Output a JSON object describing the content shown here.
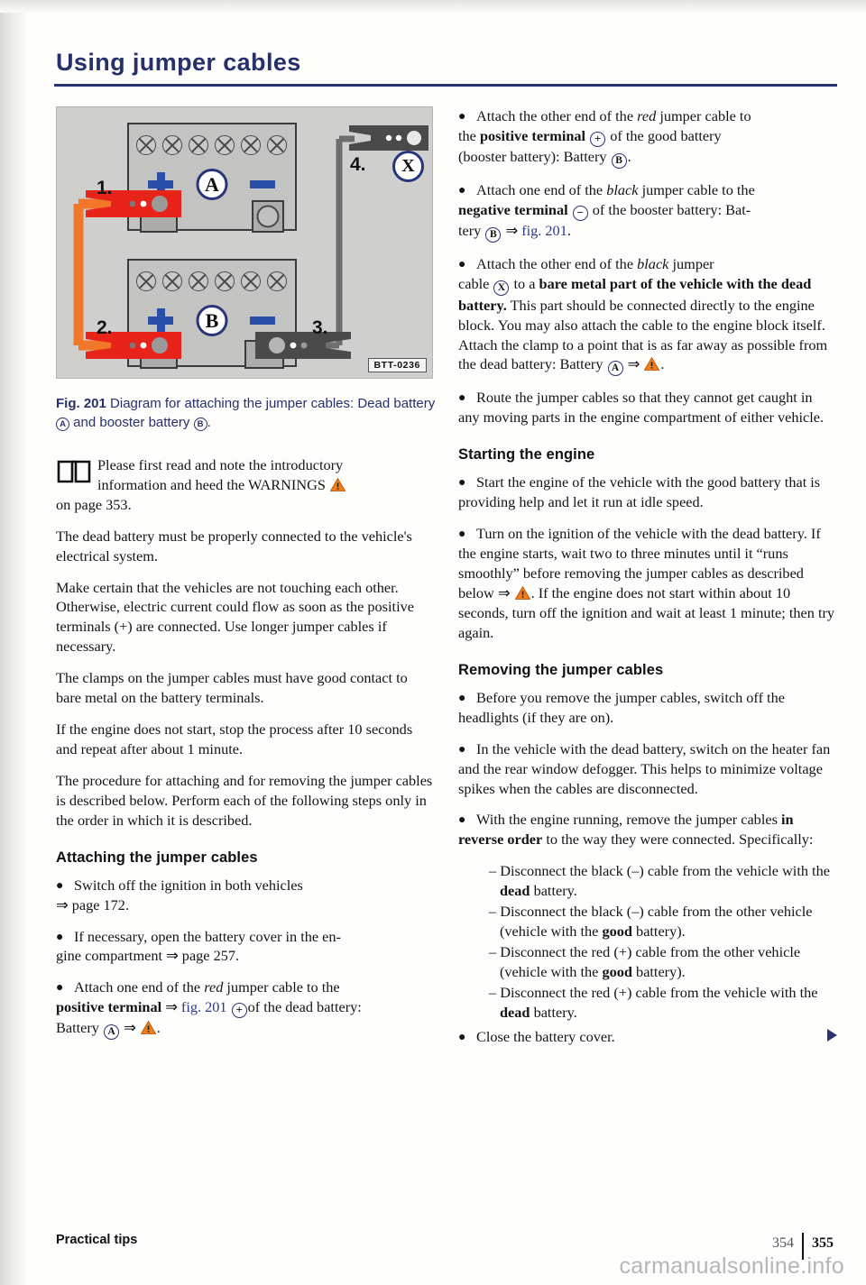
{
  "header": {
    "title": "Using jumper cables"
  },
  "figure": {
    "code": "BTT-0236",
    "caption_label": "Fig. 201",
    "caption_text": "Diagram for attaching the jumper cables: Dead battery",
    "caption_text_2": "and booster battery",
    "caption_end": ".",
    "battery_a_label": "A",
    "battery_b_label": "B",
    "ground_point_label": "X",
    "steps": [
      "1.",
      "2.",
      "3.",
      "4."
    ],
    "colors": {
      "red_cable": "#e8231a",
      "orange_cable": "#f2772a",
      "black_cable": "#4a4a4a",
      "terminal_blue": "#2b4ea8",
      "badge_blue": "#26357c"
    }
  },
  "left_column": {
    "note": {
      "line1": "Please first read and note the introductory",
      "line2_a": "information and heed the WARNINGS",
      "line3": "on page 353."
    },
    "para_dead_battery": "The dead battery must be properly connected to the vehicle's electrical system.",
    "para_touching": "Make certain that the vehicles are not touching each other. Otherwise, electric current could flow as soon as the positive terminals (+) are connected. Use longer jumper cables if necessary.",
    "para_clamps": "The clamps on the jumper cables must have good contact to bare metal on the battery terminals.",
    "para_not_start": "If the engine does not start, stop the process after 10 seconds and repeat after about 1 minute.",
    "para_procedure": "The procedure for attaching and for removing the jumper cables is described below. Perform each of the following steps only in the order in which it is described.",
    "subhead_attaching": "Attaching the jumper cables",
    "bullet_ignition_a": "Switch off the ignition in both vehicles",
    "bullet_ignition_b": "page 172.",
    "bullet_cover_a": "If necessary, open the battery cover in the en-",
    "bullet_cover_b": "gine compartment",
    "bullet_cover_c": "page 257.",
    "bullet_red_a": "Attach one end of the",
    "bullet_red_italic": "red",
    "bullet_red_b": "jumper cable to the",
    "bullet_red_bold": "positive terminal",
    "bullet_red_ref": "fig. 201",
    "bullet_red_c": "of the dead battery:",
    "bullet_red_d": "Battery"
  },
  "right_column": {
    "bullet_red_other_a": "Attach the other end of the",
    "bullet_red_other_italic": "red",
    "bullet_red_other_b": "jumper cable to",
    "bullet_red_other_c": "the",
    "bullet_red_other_bold": "positive terminal",
    "bullet_red_other_d": "of the good battery",
    "bullet_red_other_e": "(booster battery): Battery",
    "bullet_black_one_a": "Attach one end of the",
    "bullet_black_one_italic": "black",
    "bullet_black_one_b": "jumper cable to the",
    "bullet_black_one_bold": "negative terminal",
    "bullet_black_one_c": "of the booster battery: Bat-",
    "bullet_black_one_d": "tery",
    "bullet_black_one_ref": "fig. 201",
    "bullet_black_other_a": "Attach the other end of the",
    "bullet_black_other_italic": "black",
    "bullet_black_other_b": "jumper",
    "bullet_black_other_c": "cable",
    "bullet_black_other_d": "to a",
    "bullet_black_other_bold": "bare metal part of the vehicle with the dead battery.",
    "bullet_black_other_e": "This part should be connected directly to the engine block. You may also attach the cable to the engine block itself. Attach the clamp to a point that is as far away as possible from the dead battery: Battery",
    "bullet_route": "Route the jumper cables so that they cannot get caught in any moving parts in the engine compartment of either vehicle.",
    "subhead_starting": "Starting the engine",
    "bullet_start": "Start the engine of the vehicle with the good battery that is providing help and let it run at idle speed.",
    "bullet_turn_a": "Turn on the ignition of the vehicle with the dead battery. If the engine starts, wait two to three minutes until it “runs smoothly” before removing the jumper cables as described below",
    "bullet_turn_b": ". If the engine does not start within about 10 seconds, turn off the ignition and wait at least 1 minute; then try again.",
    "subhead_removing": "Removing the jumper cables",
    "bullet_headlights": "Before you remove the jumper cables, switch off the headlights (if they are on).",
    "bullet_heater": "In the vehicle with the dead battery, switch on the heater fan and the rear window defogger. This helps to minimize voltage spikes when the cables are disconnected.",
    "bullet_reverse_a": "With the engine running, remove the jumper cables",
    "bullet_reverse_bold": "in reverse order",
    "bullet_reverse_b": "to the way they were connected. Specifically:",
    "dash_items": [
      {
        "a": "– Disconnect the black (–) cable from the vehicle with the",
        "bold": "dead",
        "b": "battery."
      },
      {
        "a": "– Disconnect the black (–) cable from the other vehicle (vehicle with the",
        "bold": "good",
        "b": "battery)."
      },
      {
        "a": "– Disconnect the red (+) cable from the other vehicle (vehicle with the",
        "bold": "good",
        "b": "battery)."
      },
      {
        "a": "– Disconnect the red (+) cable from the vehicle with the",
        "bold": "dead",
        "b": "battery."
      }
    ],
    "bullet_close": "Close the battery cover."
  },
  "footer": {
    "section": "Practical tips",
    "page_prev": "354",
    "page_current": "355",
    "watermark": "carmanualsonline.info"
  }
}
